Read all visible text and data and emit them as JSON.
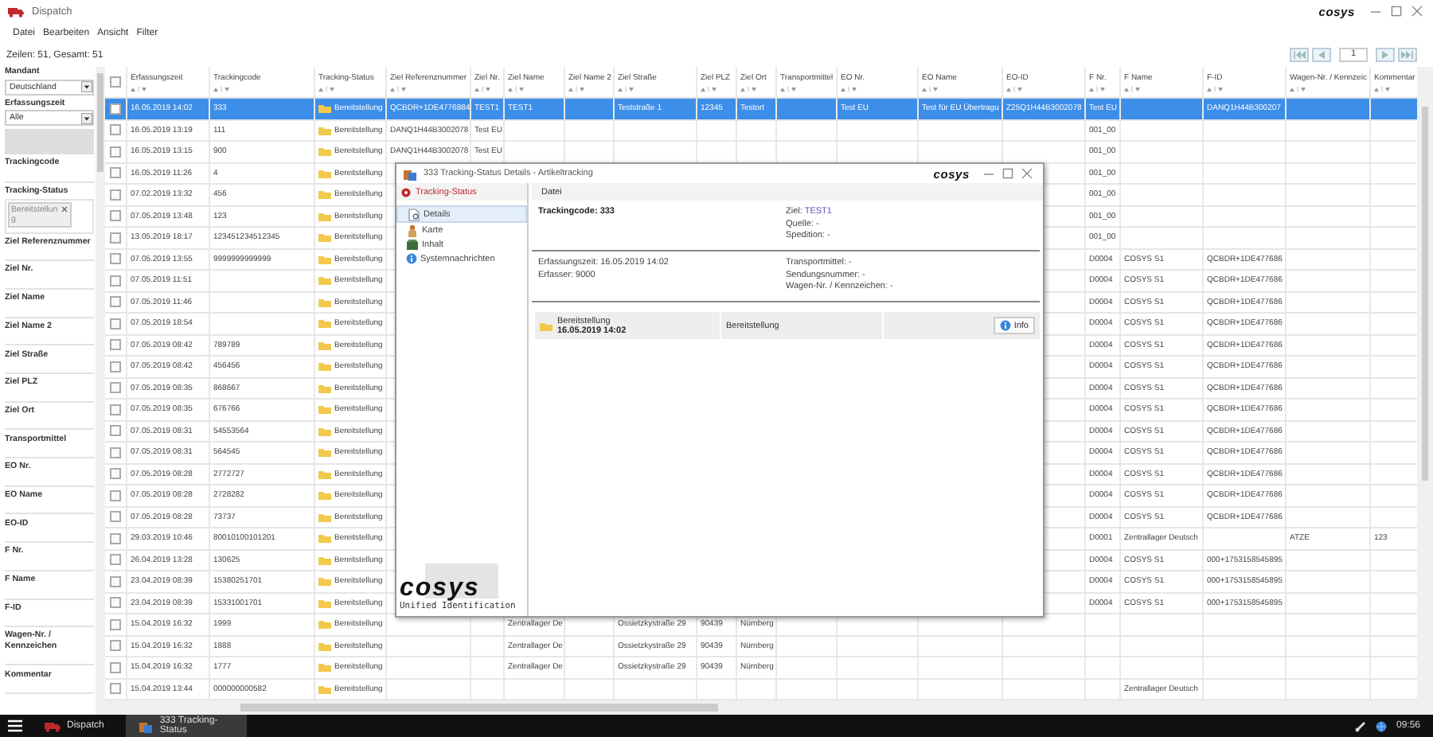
{
  "window": {
    "title": "Dispatch",
    "logo": "cosys"
  },
  "menu": [
    "Datei",
    "Bearbeiten",
    "Ansicht",
    "Filter"
  ],
  "row_count": "Zeilen: 51, Gesamt: 51",
  "pager": {
    "page": "1"
  },
  "filters": [
    {
      "kind": "select",
      "label": "Mandant",
      "value": "Deutschland"
    },
    {
      "kind": "period",
      "label": "Erfassungszeit",
      "value": "Alle"
    },
    {
      "kind": "text",
      "label": "Trackingcode"
    },
    {
      "kind": "tags",
      "label": "Tracking-Status",
      "tags": [
        "Bereitstellung"
      ]
    },
    {
      "kind": "text",
      "label": "Ziel Referenznummer"
    },
    {
      "kind": "text",
      "label": "Ziel Nr."
    },
    {
      "kind": "text",
      "label": "Ziel Name"
    },
    {
      "kind": "text",
      "label": "Ziel Name 2"
    },
    {
      "kind": "text",
      "label": "Ziel Straße"
    },
    {
      "kind": "text",
      "label": "Ziel PLZ"
    },
    {
      "kind": "text",
      "label": "Ziel Ort"
    },
    {
      "kind": "text",
      "label": "Transportmittel"
    },
    {
      "kind": "text",
      "label": "EO Nr."
    },
    {
      "kind": "text",
      "label": "EO Name"
    },
    {
      "kind": "text",
      "label": "EO-ID"
    },
    {
      "kind": "text",
      "label": "F Nr."
    },
    {
      "kind": "text",
      "label": "F Name"
    },
    {
      "kind": "text",
      "label": "F-ID"
    },
    {
      "kind": "text",
      "label": "Wagen-Nr. / Kennzeichen"
    },
    {
      "kind": "text",
      "label": "Kommentar"
    }
  ],
  "table": {
    "header_checked": false,
    "columns": [
      {
        "label": "Erfassungszeit",
        "kind": "text"
      },
      {
        "label": "Trackingcode",
        "kind": "text"
      },
      {
        "label": "Tracking-Status",
        "kind": "status"
      },
      {
        "label": "Ziel Referenznummer",
        "kind": "text"
      },
      {
        "label": "Ziel Nr.",
        "kind": "text"
      },
      {
        "label": "Ziel Name",
        "kind": "text"
      },
      {
        "label": "Ziel Name 2",
        "kind": "text"
      },
      {
        "label": "Ziel Straße",
        "kind": "text"
      },
      {
        "label": "Ziel PLZ",
        "kind": "text"
      },
      {
        "label": "Ziel Ort",
        "kind": "text"
      },
      {
        "label": "Transportmittel",
        "kind": "text"
      },
      {
        "label": "EO Nr.",
        "kind": "text"
      },
      {
        "label": "EO Name",
        "kind": "text"
      },
      {
        "label": "EO-ID",
        "kind": "text"
      },
      {
        "label": "F Nr.",
        "kind": "text"
      },
      {
        "label": "F Name",
        "kind": "text"
      },
      {
        "label": "F-ID",
        "kind": "text"
      },
      {
        "label": "Wagen-Nr. / Kennzeic",
        "kind": "text"
      },
      {
        "label": "Kommentar",
        "kind": "text"
      }
    ],
    "rows": [
      {
        "selected": true,
        "checked": false,
        "cells": [
          "16.05.2019 14:02",
          "333",
          "Bereitstellung",
          "QCBDR+1DE4776884",
          "TEST1",
          "TEST1",
          null,
          "Teststraße 1",
          "12345",
          "Testort",
          null,
          "Test EU",
          "Test für EU Übertragu",
          "Z25Q1H44B3002078",
          "Test EU",
          null,
          "DANQ1H44B300207",
          null,
          null
        ]
      },
      {
        "selected": false,
        "checked": false,
        "cells": [
          "16.05.2019 13:19",
          "111",
          "Bereitstellung",
          "DANQ1H44B3002078",
          "Test EU",
          null,
          null,
          null,
          null,
          null,
          null,
          null,
          null,
          null,
          "001_00",
          null,
          null,
          null,
          null
        ]
      },
      {
        "selected": false,
        "checked": false,
        "cells": [
          "16.05.2019 13:15",
          "900",
          "Bereitstellung",
          "DANQ1H44B3002078",
          "Test EU",
          null,
          null,
          null,
          null,
          null,
          null,
          null,
          null,
          null,
          "001_00",
          null,
          null,
          null,
          null
        ]
      },
      {
        "selected": false,
        "checked": false,
        "cells": [
          "16.05.2019 11:26",
          "4",
          "Bereitstellung",
          null,
          null,
          null,
          null,
          null,
          null,
          null,
          null,
          null,
          null,
          null,
          "001_00",
          null,
          null,
          null,
          null
        ]
      },
      {
        "selected": false,
        "checked": false,
        "cells": [
          "07.02.2019 13:32",
          "456",
          "Bereitstellung",
          null,
          null,
          null,
          null,
          null,
          null,
          null,
          null,
          null,
          null,
          null,
          "001_00",
          null,
          null,
          null,
          null
        ]
      },
      {
        "selected": false,
        "checked": false,
        "cells": [
          "07.05.2019 13:48",
          "123",
          "Bereitstellung",
          null,
          null,
          null,
          null,
          null,
          null,
          null,
          null,
          null,
          null,
          null,
          "001_00",
          null,
          null,
          null,
          null
        ]
      },
      {
        "selected": false,
        "checked": false,
        "cells": [
          "13.05.2019 18:17",
          "123451234512345",
          "Bereitstellung",
          null,
          null,
          null,
          null,
          null,
          null,
          null,
          null,
          null,
          null,
          null,
          "001_00",
          null,
          null,
          null,
          null
        ]
      },
      {
        "selected": false,
        "checked": false,
        "cells": [
          "07.05.2019 13:55",
          "9999999999999",
          "Bereitstellung",
          null,
          null,
          null,
          null,
          null,
          null,
          null,
          null,
          null,
          null,
          null,
          "D0004",
          "COSYS S1",
          "QCBDR+1DE477686",
          null,
          null
        ]
      },
      {
        "selected": false,
        "checked": false,
        "cells": [
          "07.05.2019 11:51",
          null,
          "Bereitstellung",
          null,
          null,
          null,
          null,
          null,
          null,
          null,
          null,
          null,
          null,
          null,
          "D0004",
          "COSYS S1",
          "QCBDR+1DE477686",
          null,
          null
        ]
      },
      {
        "selected": false,
        "checked": false,
        "cells": [
          "07.05.2019 11:46",
          null,
          "Bereitstellung",
          null,
          null,
          null,
          null,
          null,
          null,
          null,
          null,
          null,
          null,
          null,
          "D0004",
          "COSYS S1",
          "QCBDR+1DE477686",
          null,
          null
        ]
      },
      {
        "selected": false,
        "checked": false,
        "cells": [
          "07.05.2019 18:54",
          null,
          "Bereitstellung",
          null,
          null,
          null,
          null,
          null,
          null,
          null,
          null,
          null,
          null,
          null,
          "D0004",
          "COSYS S1",
          "QCBDR+1DE477686",
          null,
          null
        ]
      },
      {
        "selected": false,
        "checked": false,
        "cells": [
          "07.05.2019 08:42",
          "789789",
          "Bereitstellung",
          null,
          null,
          null,
          null,
          null,
          null,
          null,
          null,
          null,
          null,
          null,
          "D0004",
          "COSYS S1",
          "QCBDR+1DE477686",
          null,
          null
        ]
      },
      {
        "selected": false,
        "checked": false,
        "cells": [
          "07.05.2019 08:42",
          "456456",
          "Bereitstellung",
          null,
          null,
          null,
          null,
          null,
          null,
          null,
          null,
          null,
          null,
          null,
          "D0004",
          "COSYS S1",
          "QCBDR+1DE477686",
          null,
          null
        ]
      },
      {
        "selected": false,
        "checked": false,
        "cells": [
          "07.05.2019 08:35",
          "868667",
          "Bereitstellung",
          null,
          null,
          null,
          null,
          null,
          null,
          null,
          null,
          null,
          null,
          null,
          "D0004",
          "COSYS S1",
          "QCBDR+1DE477686",
          null,
          null
        ]
      },
      {
        "selected": false,
        "checked": false,
        "cells": [
          "07.05.2019 08:35",
          "676766",
          "Bereitstellung",
          null,
          null,
          null,
          null,
          null,
          null,
          null,
          null,
          null,
          null,
          null,
          "D0004",
          "COSYS S1",
          "QCBDR+1DE477686",
          null,
          null
        ]
      },
      {
        "selected": false,
        "checked": false,
        "cells": [
          "07.05.2019 08:31",
          "54553564",
          "Bereitstellung",
          null,
          null,
          null,
          null,
          null,
          null,
          null,
          null,
          null,
          null,
          null,
          "D0004",
          "COSYS S1",
          "QCBDR+1DE477686",
          null,
          null
        ]
      },
      {
        "selected": false,
        "checked": false,
        "cells": [
          "07.05.2019 08:31",
          "564545",
          "Bereitstellung",
          null,
          null,
          null,
          null,
          null,
          null,
          null,
          null,
          null,
          null,
          null,
          "D0004",
          "COSYS S1",
          "QCBDR+1DE477686",
          null,
          null
        ]
      },
      {
        "selected": false,
        "checked": false,
        "cells": [
          "07.05.2019 08:28",
          "2772727",
          "Bereitstellung",
          null,
          null,
          null,
          null,
          null,
          null,
          null,
          null,
          null,
          null,
          null,
          "D0004",
          "COSYS S1",
          "QCBDR+1DE477686",
          null,
          null
        ]
      },
      {
        "selected": false,
        "checked": false,
        "cells": [
          "07.05.2019 08:28",
          "2728282",
          "Bereitstellung",
          null,
          null,
          null,
          null,
          null,
          null,
          null,
          null,
          null,
          null,
          null,
          "D0004",
          "COSYS S1",
          "QCBDR+1DE477686",
          null,
          null
        ]
      },
      {
        "selected": false,
        "checked": false,
        "cells": [
          "07.05.2019 08:28",
          "73737",
          "Bereitstellung",
          null,
          null,
          null,
          null,
          null,
          null,
          null,
          null,
          null,
          null,
          null,
          "D0004",
          "COSYS S1",
          "QCBDR+1DE477686",
          null,
          null
        ]
      },
      {
        "selected": false,
        "checked": false,
        "cells": [
          "29.03.2019 10:46",
          "80010100101201",
          "Bereitstellung",
          null,
          null,
          null,
          null,
          null,
          null,
          null,
          null,
          null,
          null,
          null,
          "D0001",
          "Zentrallager Deutsch",
          null,
          "ATZE",
          "123"
        ]
      },
      {
        "selected": false,
        "checked": false,
        "cells": [
          "26.04.2019 13:28",
          "130625",
          "Bereitstellung",
          null,
          null,
          null,
          null,
          null,
          null,
          null,
          null,
          null,
          null,
          null,
          "D0004",
          "COSYS S1",
          "000+1753158545895",
          null,
          null
        ]
      },
      {
        "selected": false,
        "checked": false,
        "cells": [
          "23.04.2019 08:39",
          "15380251701",
          "Bereitstellung",
          null,
          null,
          null,
          null,
          null,
          null,
          null,
          null,
          null,
          null,
          null,
          "D0004",
          "COSYS S1",
          "000+1753158545895",
          null,
          null
        ]
      },
      {
        "selected": false,
        "checked": false,
        "cells": [
          "23.04.2019 08:39",
          "15331001701",
          "Bereitstellung",
          null,
          null,
          null,
          null,
          null,
          null,
          null,
          null,
          null,
          null,
          null,
          "D0004",
          "COSYS S1",
          "000+1753158545895",
          null,
          null
        ]
      },
      {
        "selected": false,
        "checked": false,
        "cells": [
          "15.04.2019 16:32",
          "1999",
          "Bereitstellung",
          null,
          null,
          "Zentrallager De",
          null,
          "Ossietzkystraße 29",
          "90439",
          "Nürnberg",
          null,
          null,
          null,
          null,
          null,
          null,
          null,
          null,
          null
        ]
      },
      {
        "selected": false,
        "checked": false,
        "cells": [
          "15.04.2019 16:32",
          "1888",
          "Bereitstellung",
          null,
          null,
          "Zentrallager De",
          null,
          "Ossietzkystraße 29",
          "90439",
          "Nürnberg",
          null,
          null,
          null,
          null,
          null,
          null,
          null,
          null,
          null
        ]
      },
      {
        "selected": false,
        "checked": false,
        "cells": [
          "15.04.2019 16:32",
          "1777",
          "Bereitstellung",
          null,
          null,
          "Zentrallager De",
          null,
          "Ossietzkystraße 29",
          "90439",
          "Nürnberg",
          null,
          null,
          null,
          null,
          null,
          null,
          null,
          null,
          null
        ]
      },
      {
        "selected": false,
        "checked": false,
        "cells": [
          "15.04.2019 13:44",
          "000000000582",
          "Bereitstellung",
          null,
          null,
          null,
          null,
          null,
          null,
          null,
          null,
          null,
          null,
          null,
          null,
          "Zentrallager Deutsch",
          null,
          null,
          null
        ]
      }
    ]
  },
  "dialog": {
    "title": "333 Tracking-Status Details - Artikeltracking",
    "logo": "cosys",
    "nav_header": "Tracking-Status",
    "nav": [
      {
        "label": "Details",
        "selected": true
      },
      {
        "label": "Karte",
        "selected": false
      },
      {
        "label": "Inhalt",
        "selected": false
      },
      {
        "label": "Systemnachrichten",
        "selected": false
      }
    ],
    "brand": {
      "logo": "cosys",
      "tagline": "Unified Identification"
    },
    "menu": [
      "Datei"
    ],
    "sections": [
      {
        "left": [
          {
            "kind": "heading",
            "text": "Trackingcode: 333"
          }
        ],
        "right": [
          {
            "kind": "link",
            "text": "Ziel:",
            "link": "TEST1"
          },
          {
            "kind": "text",
            "text": "Quelle: -"
          },
          {
            "kind": "text",
            "text": "Spedition: -"
          }
        ]
      },
      {
        "left": [
          {
            "kind": "text",
            "text": "Erfassungszeit: 16.05.2019 14:02"
          },
          {
            "kind": "text",
            "text": "Erfasser: 9000"
          }
        ],
        "right": [
          {
            "kind": "text",
            "text": "Transportmittel: -"
          },
          {
            "kind": "text",
            "text": "Sendungsnummer: -"
          },
          {
            "kind": "text",
            "text": "Wagen-Nr. / Kennzeichen: -"
          }
        ]
      }
    ],
    "events": [
      {
        "status": "Bereitstellung",
        "time": "16.05.2019 14:02",
        "description": "Bereitstellung",
        "action": "Info"
      }
    ]
  },
  "taskbar": {
    "apps": [
      {
        "label": "Dispatch",
        "selected": false
      },
      {
        "label": "333 Tracking-Status",
        "selected": true
      }
    ],
    "clock": "09:56"
  }
}
